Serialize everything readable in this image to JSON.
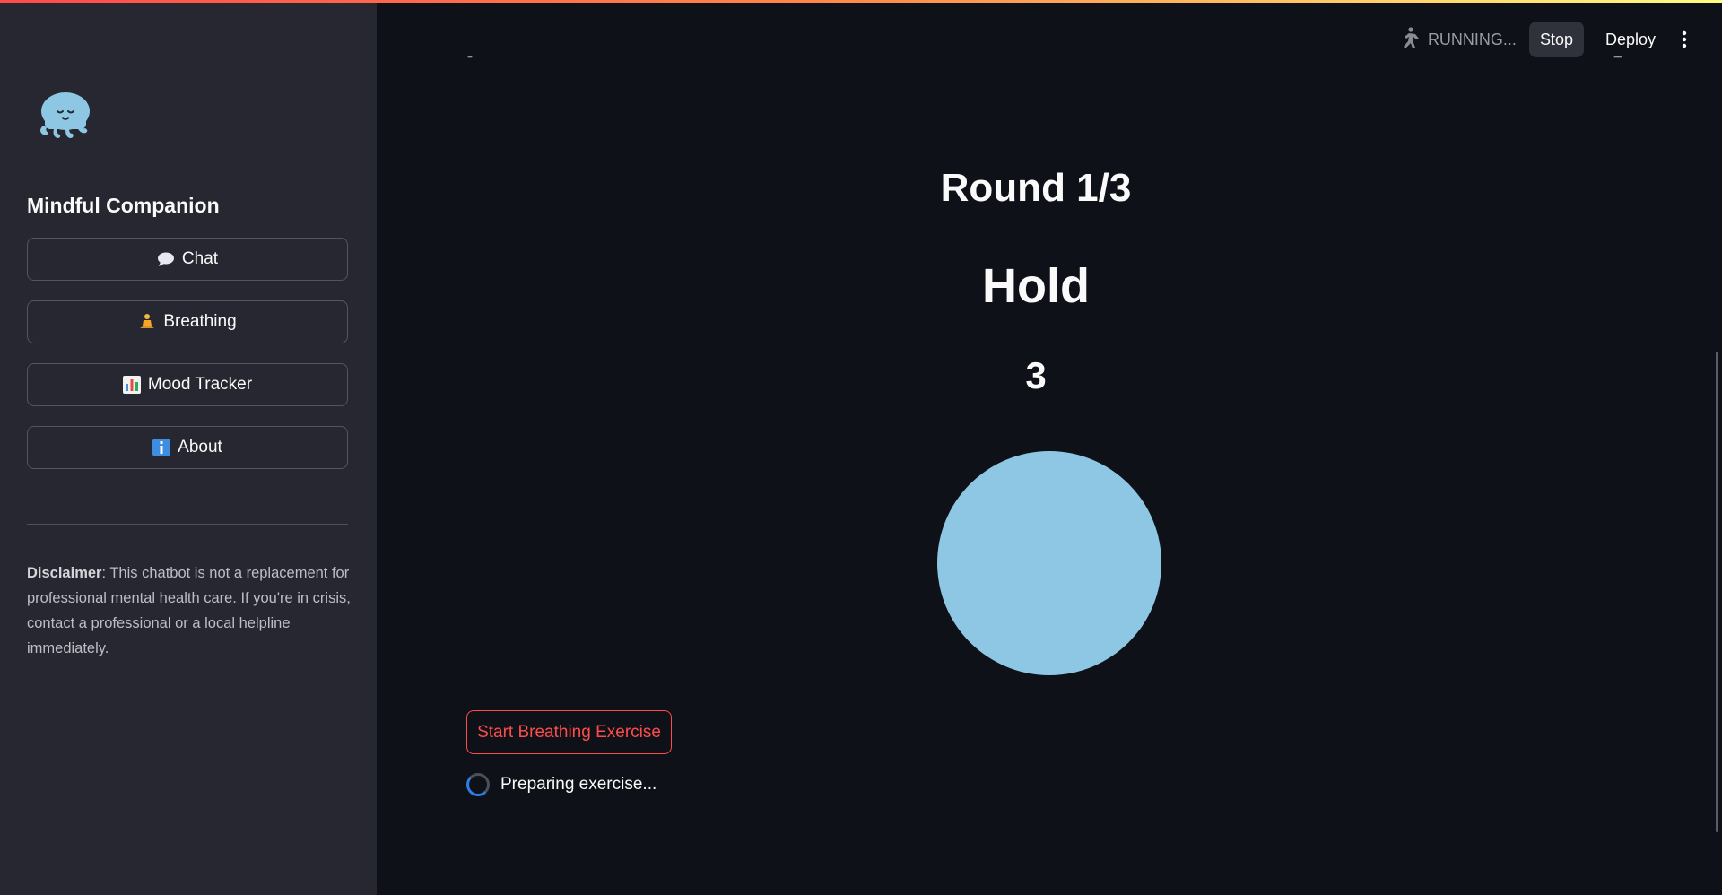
{
  "header": {
    "status": "RUNNING...",
    "stop_label": "Stop",
    "deploy_label": "Deploy",
    "running_icon": "running-person-icon",
    "menu_icon": "kebab-menu-icon"
  },
  "sidebar": {
    "title": "Mind­ful Companion",
    "logo_icon": "octopus-logo-icon",
    "items": [
      {
        "label": "Chat",
        "icon": "speech-bubble-icon"
      },
      {
        "label": "Breathing",
        "icon": "meditation-icon"
      },
      {
        "label": "Mood Tracker",
        "icon": "bar-chart-icon"
      },
      {
        "label": "About",
        "icon": "info-icon"
      }
    ],
    "disclaimer_bold": "Disclaimer",
    "disclaimer_text": ": This chatbot is not a replacement for professional mental health care. If you're in crisis, contact a professional or a local helpline immediately."
  },
  "main": {
    "round": "Round 1/3",
    "phase": "Hold",
    "count": "3",
    "circle_color": "#8ec7e4",
    "start_button": "Start Breathing Exercise",
    "status_text": "Preparing exercise..."
  },
  "colors": {
    "accent": "#ff4b4b",
    "background": "#0e1117",
    "sidebar": "#262730",
    "spinner": "#2b7de9"
  }
}
